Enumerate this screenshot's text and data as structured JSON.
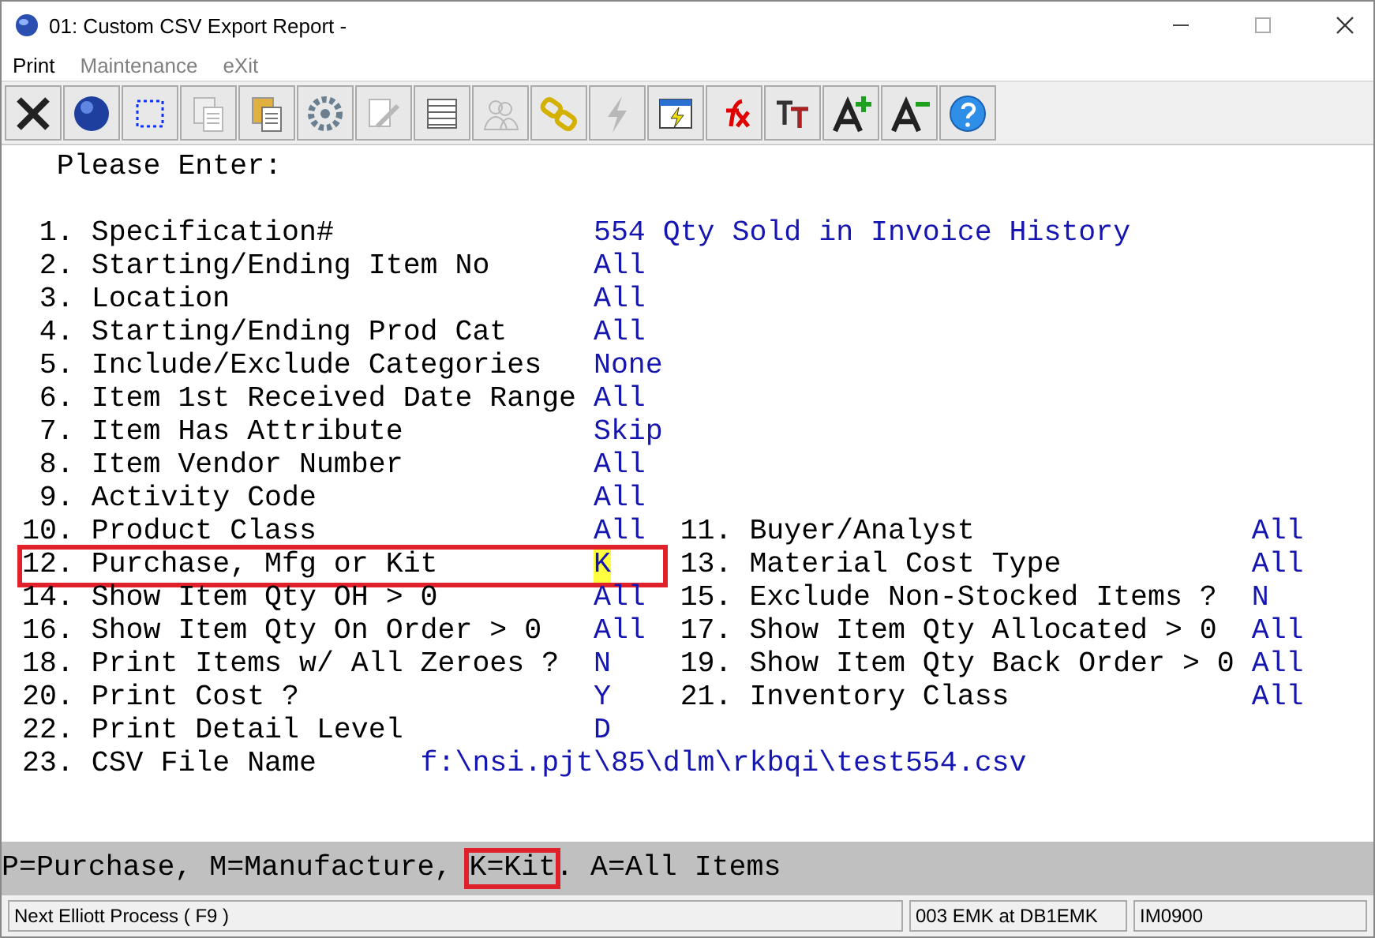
{
  "window": {
    "title": "01: Custom CSV Export Report -"
  },
  "menu": [
    {
      "label": "Print",
      "disabled": false
    },
    {
      "label": "Maintenance",
      "disabled": true
    },
    {
      "label": "eXit",
      "disabled": true
    }
  ],
  "toolbar": [
    {
      "kind": "close",
      "disabled": false
    },
    {
      "kind": "globe",
      "disabled": false
    },
    {
      "kind": "select",
      "disabled": false
    },
    {
      "kind": "copy",
      "disabled": true
    },
    {
      "kind": "paste",
      "disabled": false
    },
    {
      "kind": "gear",
      "disabled": false
    },
    {
      "kind": "edit",
      "disabled": true
    },
    {
      "kind": "table",
      "disabled": false
    },
    {
      "kind": "people",
      "disabled": true
    },
    {
      "kind": "chain",
      "disabled": false
    },
    {
      "kind": "bolt",
      "disabled": true
    },
    {
      "kind": "window-bolt",
      "disabled": false
    },
    {
      "kind": "fx",
      "disabled": false
    },
    {
      "kind": "font",
      "disabled": false
    },
    {
      "kind": "font-up",
      "disabled": false
    },
    {
      "kind": "font-down",
      "disabled": false
    },
    {
      "kind": "help",
      "disabled": false
    }
  ],
  "prompt": "Please Enter:",
  "rows": [
    {
      "kind": "single",
      "left": {
        "num": "1.",
        "label": "Specification#",
        "value": "554 Qty Sold in Invoice History"
      }
    },
    {
      "kind": "single",
      "left": {
        "num": "2.",
        "label": "Starting/Ending Item No",
        "value": "All"
      }
    },
    {
      "kind": "single",
      "left": {
        "num": "3.",
        "label": "Location",
        "value": "All"
      }
    },
    {
      "kind": "single",
      "left": {
        "num": "4.",
        "label": "Starting/Ending Prod Cat",
        "value": "All"
      }
    },
    {
      "kind": "single",
      "left": {
        "num": "5.",
        "label": "Include/Exclude Categories",
        "value": "None"
      }
    },
    {
      "kind": "single",
      "left": {
        "num": "6.",
        "label": "Item 1st Received Date Range",
        "value": "All"
      }
    },
    {
      "kind": "single",
      "left": {
        "num": "7.",
        "label": "Item Has Attribute",
        "value": "Skip"
      }
    },
    {
      "kind": "single",
      "left": {
        "num": "8.",
        "label": "Item Vendor Number",
        "value": "All"
      }
    },
    {
      "kind": "single",
      "left": {
        "num": "9.",
        "label": "Activity Code",
        "value": "All"
      }
    },
    {
      "kind": "pair",
      "left": {
        "num": "10.",
        "label": "Product Class",
        "value": "All"
      },
      "right": {
        "num": "11.",
        "label": "Buyer/Analyst",
        "value": "All"
      }
    },
    {
      "kind": "pair",
      "left": {
        "num": "12.",
        "label": "Purchase, Mfg or Kit",
        "value": "K",
        "highlighted": true,
        "cursor": true
      },
      "right": {
        "num": "13.",
        "label": "Material Cost Type",
        "value": "All"
      }
    },
    {
      "kind": "pair",
      "left": {
        "num": "14.",
        "label": "Show Item Qty OH > 0",
        "value": "All"
      },
      "right": {
        "num": "15.",
        "label": "Exclude Non-Stocked Items ?",
        "value": "N"
      }
    },
    {
      "kind": "pair",
      "left": {
        "num": "16.",
        "label": "Show Item Qty On Order > 0",
        "value": "All"
      },
      "right": {
        "num": "17.",
        "label": "Show Item Qty Allocated > 0",
        "value": "All"
      }
    },
    {
      "kind": "pair",
      "left": {
        "num": "18.",
        "label": "Print Items w/ All Zeroes ?",
        "value": "N"
      },
      "right": {
        "num": "19.",
        "label": "Show Item Qty Back Order > 0",
        "value": "All"
      }
    },
    {
      "kind": "pair",
      "left": {
        "num": "20.",
        "label": "Print Cost ?",
        "value": "Y"
      },
      "right": {
        "num": "21.",
        "label": "Inventory Class",
        "value": "All"
      }
    },
    {
      "kind": "single",
      "left": {
        "num": "22.",
        "label": "Print Detail Level",
        "value": "D"
      }
    },
    {
      "kind": "path",
      "left": {
        "num": "23.",
        "label": "CSV File Name",
        "value": "f:\\nsi.pjt\\85\\dlm\\rkbqi\\test554.csv"
      }
    }
  ],
  "hint": [
    {
      "text": "P=Purchase, M=Manufacture, ",
      "highlighted": false
    },
    {
      "text": "K=Kit",
      "highlighted": true
    },
    {
      "text": ". A=All Items",
      "highlighted": false
    }
  ],
  "status_bar": [
    "Next Elliott Process ( F9 )",
    "003 EMK at DB1EMK",
    "IM0900"
  ]
}
